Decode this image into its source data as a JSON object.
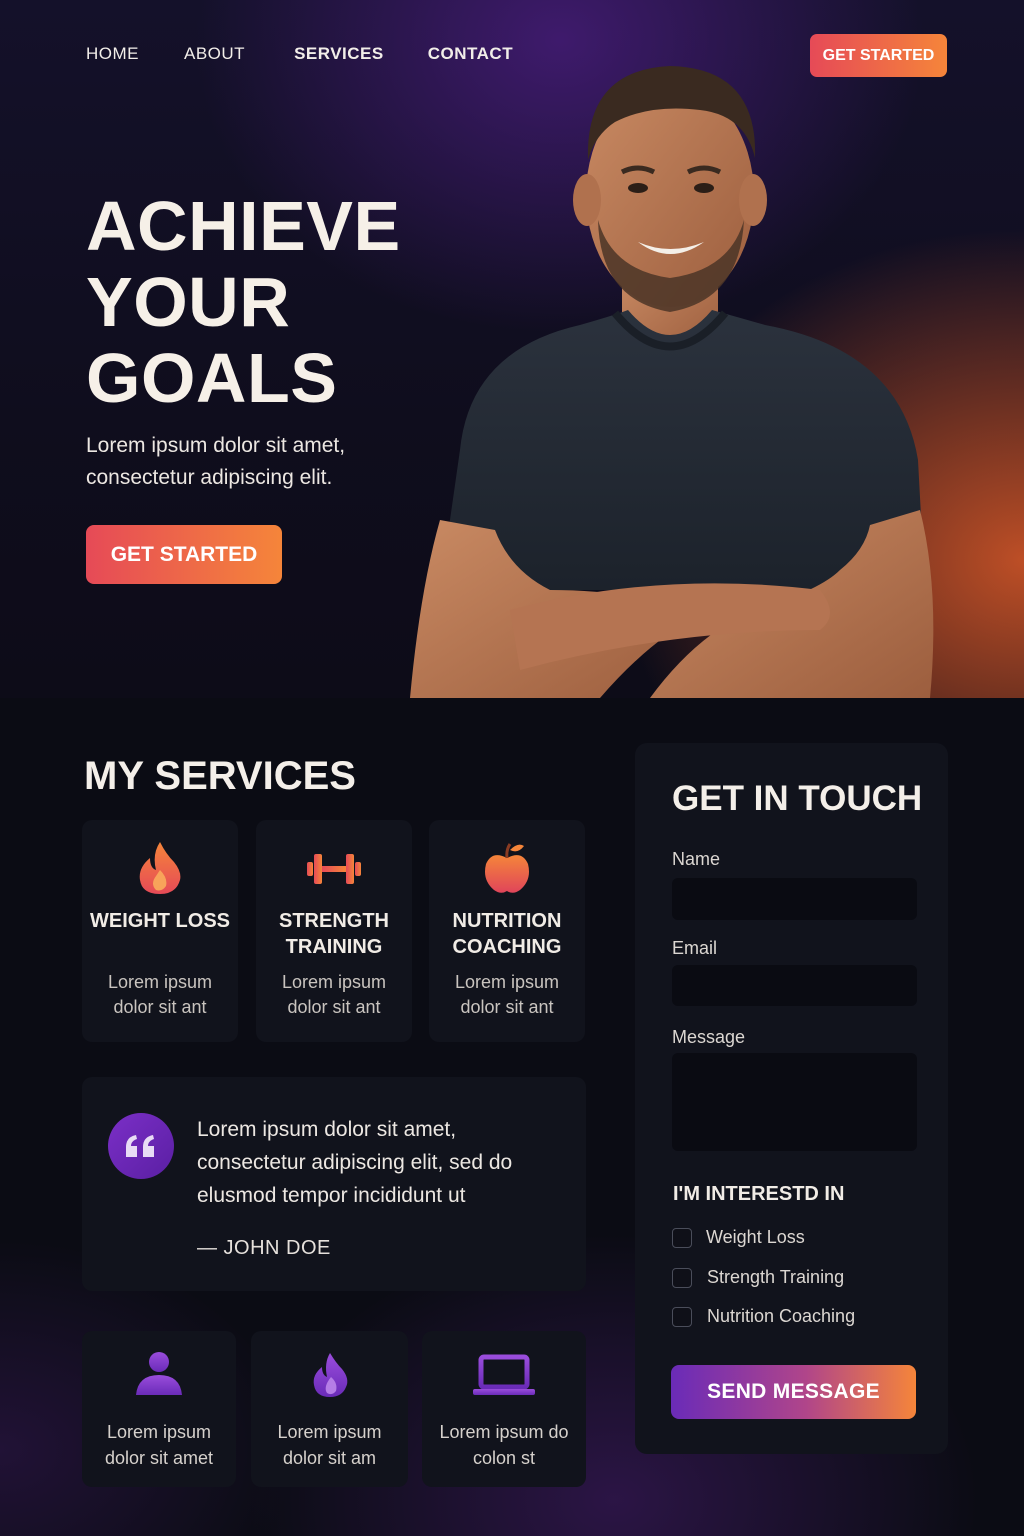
{
  "nav": {
    "items": [
      {
        "label": "HOME"
      },
      {
        "label": "ABOUT"
      },
      {
        "label": "SERVICES"
      },
      {
        "label": "CONTACT"
      }
    ],
    "cta_label": "GET STARTED"
  },
  "hero": {
    "title_lines": [
      "ACHIEVE",
      "YOUR",
      "GOALS"
    ],
    "subtitle": "Lorem ipsum dolor sit amet, consectetur adipiscing elit.",
    "cta_label": "GET STARTED"
  },
  "services": {
    "title": "MY SERVICES",
    "cards": [
      {
        "icon": "flame-icon",
        "name": "WEIGHT LOSS",
        "desc": "Lorem ipsum dolor sit ant"
      },
      {
        "icon": "dumbbell-icon",
        "name": "STRENGTH TRAINING",
        "desc": "Lorem ipsum dolor sit ant"
      },
      {
        "icon": "apple-icon",
        "name": "NUTRITION COACHING",
        "desc": "Lorem ipsum dolor sit ant"
      }
    ]
  },
  "testimonial": {
    "icon": "quote-icon",
    "text": "Lorem ipsum dolor sit amet, consectetur adipiscing elit, sed do elusmod tempor incididunt ut",
    "author": "— JOHN DOE"
  },
  "features": [
    {
      "icon": "person-icon",
      "desc": "Lorem ipsum dolor sit amet"
    },
    {
      "icon": "flame-icon",
      "desc": "Lorem ipsum dolor sit am"
    },
    {
      "icon": "laptop-icon",
      "desc": "Lorem ipsum do colon st"
    }
  ],
  "contact": {
    "title": "GET IN TOUCH",
    "name_label": "Name",
    "name_value": "",
    "email_label": "Email",
    "email_value": "",
    "message_label": "Message",
    "message_value": "",
    "interest_title": "I'M INTERESTD IN",
    "interests": [
      {
        "label": "Weight Loss",
        "checked": false
      },
      {
        "label": "Strength Training",
        "checked": false
      },
      {
        "label": "Nutrition Coaching",
        "checked": false
      }
    ],
    "send_label": "SEND MESSAGE"
  },
  "colors": {
    "background": "#0b0c14",
    "card": "#11131c",
    "accent_orange": "#f5853a",
    "accent_red": "#e64a57",
    "accent_purple": "#6a2bb8"
  }
}
